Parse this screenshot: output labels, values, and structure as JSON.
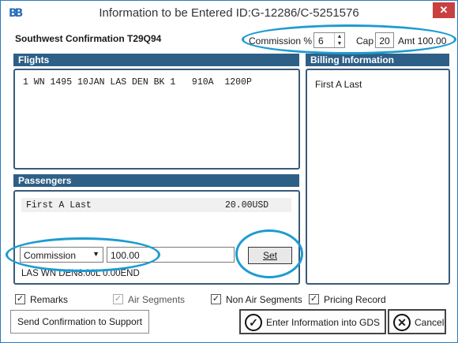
{
  "window": {
    "app_icon": "BB",
    "title": "Information to be Entered   ID:G-12286/C-5251576",
    "close_glyph": "✕"
  },
  "header": {
    "confirmation": "Southwest Confirmation T29Q94",
    "commission_label": "Commission %",
    "commission_value": "6",
    "cap_label": "Cap",
    "cap_value": "20",
    "amt_label": "Amt 100.00"
  },
  "flights": {
    "heading": "Flights",
    "lines": [
      "1 WN 1495 10JAN LAS DEN BK 1   910A  1200P"
    ]
  },
  "billing": {
    "heading": "Billing Information",
    "name": "First A Last"
  },
  "passengers": {
    "heading": "Passengers",
    "rows": [
      {
        "name": "First A Last",
        "amount": "20.00USD"
      }
    ],
    "select_value": "Commission",
    "amount_value": "100.00",
    "set_label": "Set",
    "end_text": "LAS WN DEN8.00L 0.00END"
  },
  "options": [
    {
      "label": "Remarks",
      "checked": true,
      "disabled": false
    },
    {
      "label": "Air Segments",
      "checked": true,
      "disabled": true
    },
    {
      "label": "Non Air Segments",
      "checked": true,
      "disabled": false
    },
    {
      "label": "Pricing Record",
      "checked": true,
      "disabled": false
    }
  ],
  "buttons": {
    "send": "Send Confirmation to Support",
    "enter": "Enter Information into GDS",
    "cancel": "Cancel"
  },
  "colors": {
    "panel_header": "#2e5f86",
    "highlight_ring": "#1e9bd0",
    "window_border": "#2b7bbf"
  }
}
